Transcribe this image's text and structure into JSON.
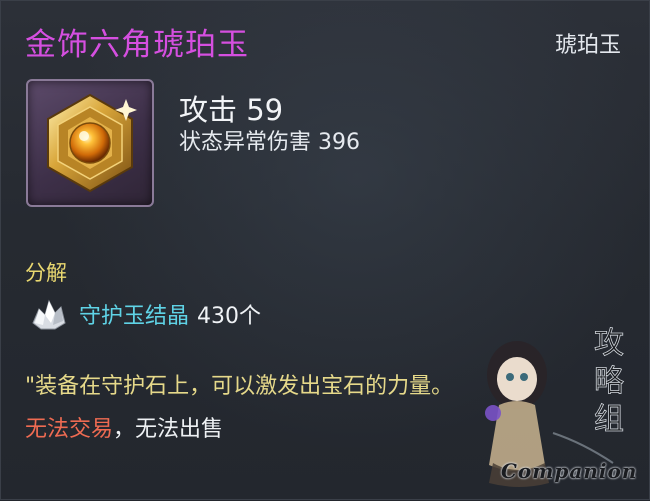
{
  "item": {
    "name": "金饰六角琥珀玉",
    "category": "琥珀玉",
    "stat_main": "攻击 59",
    "stat_sub": "状态异常伤害 396",
    "icon": "hexagonal-amber-gem-icon"
  },
  "decompose": {
    "label": "分解",
    "material": {
      "icon": "crystal-shard-icon",
      "name": "守护玉结晶",
      "count": "430个"
    }
  },
  "flavor_text": "\"装备在守护石上，可以激发出宝石的力量。",
  "trade": {
    "no_trade": "无法交易",
    "separator": "，",
    "no_sell": "无法出售"
  },
  "watermark": {
    "text": "Companion",
    "seal_chars": "攻略组"
  },
  "colors": {
    "title": "#d54fe0",
    "section": "#e9d870",
    "material": "#5fd3e6",
    "flavor": "#e6d98a",
    "warning": "#ef6b52"
  }
}
